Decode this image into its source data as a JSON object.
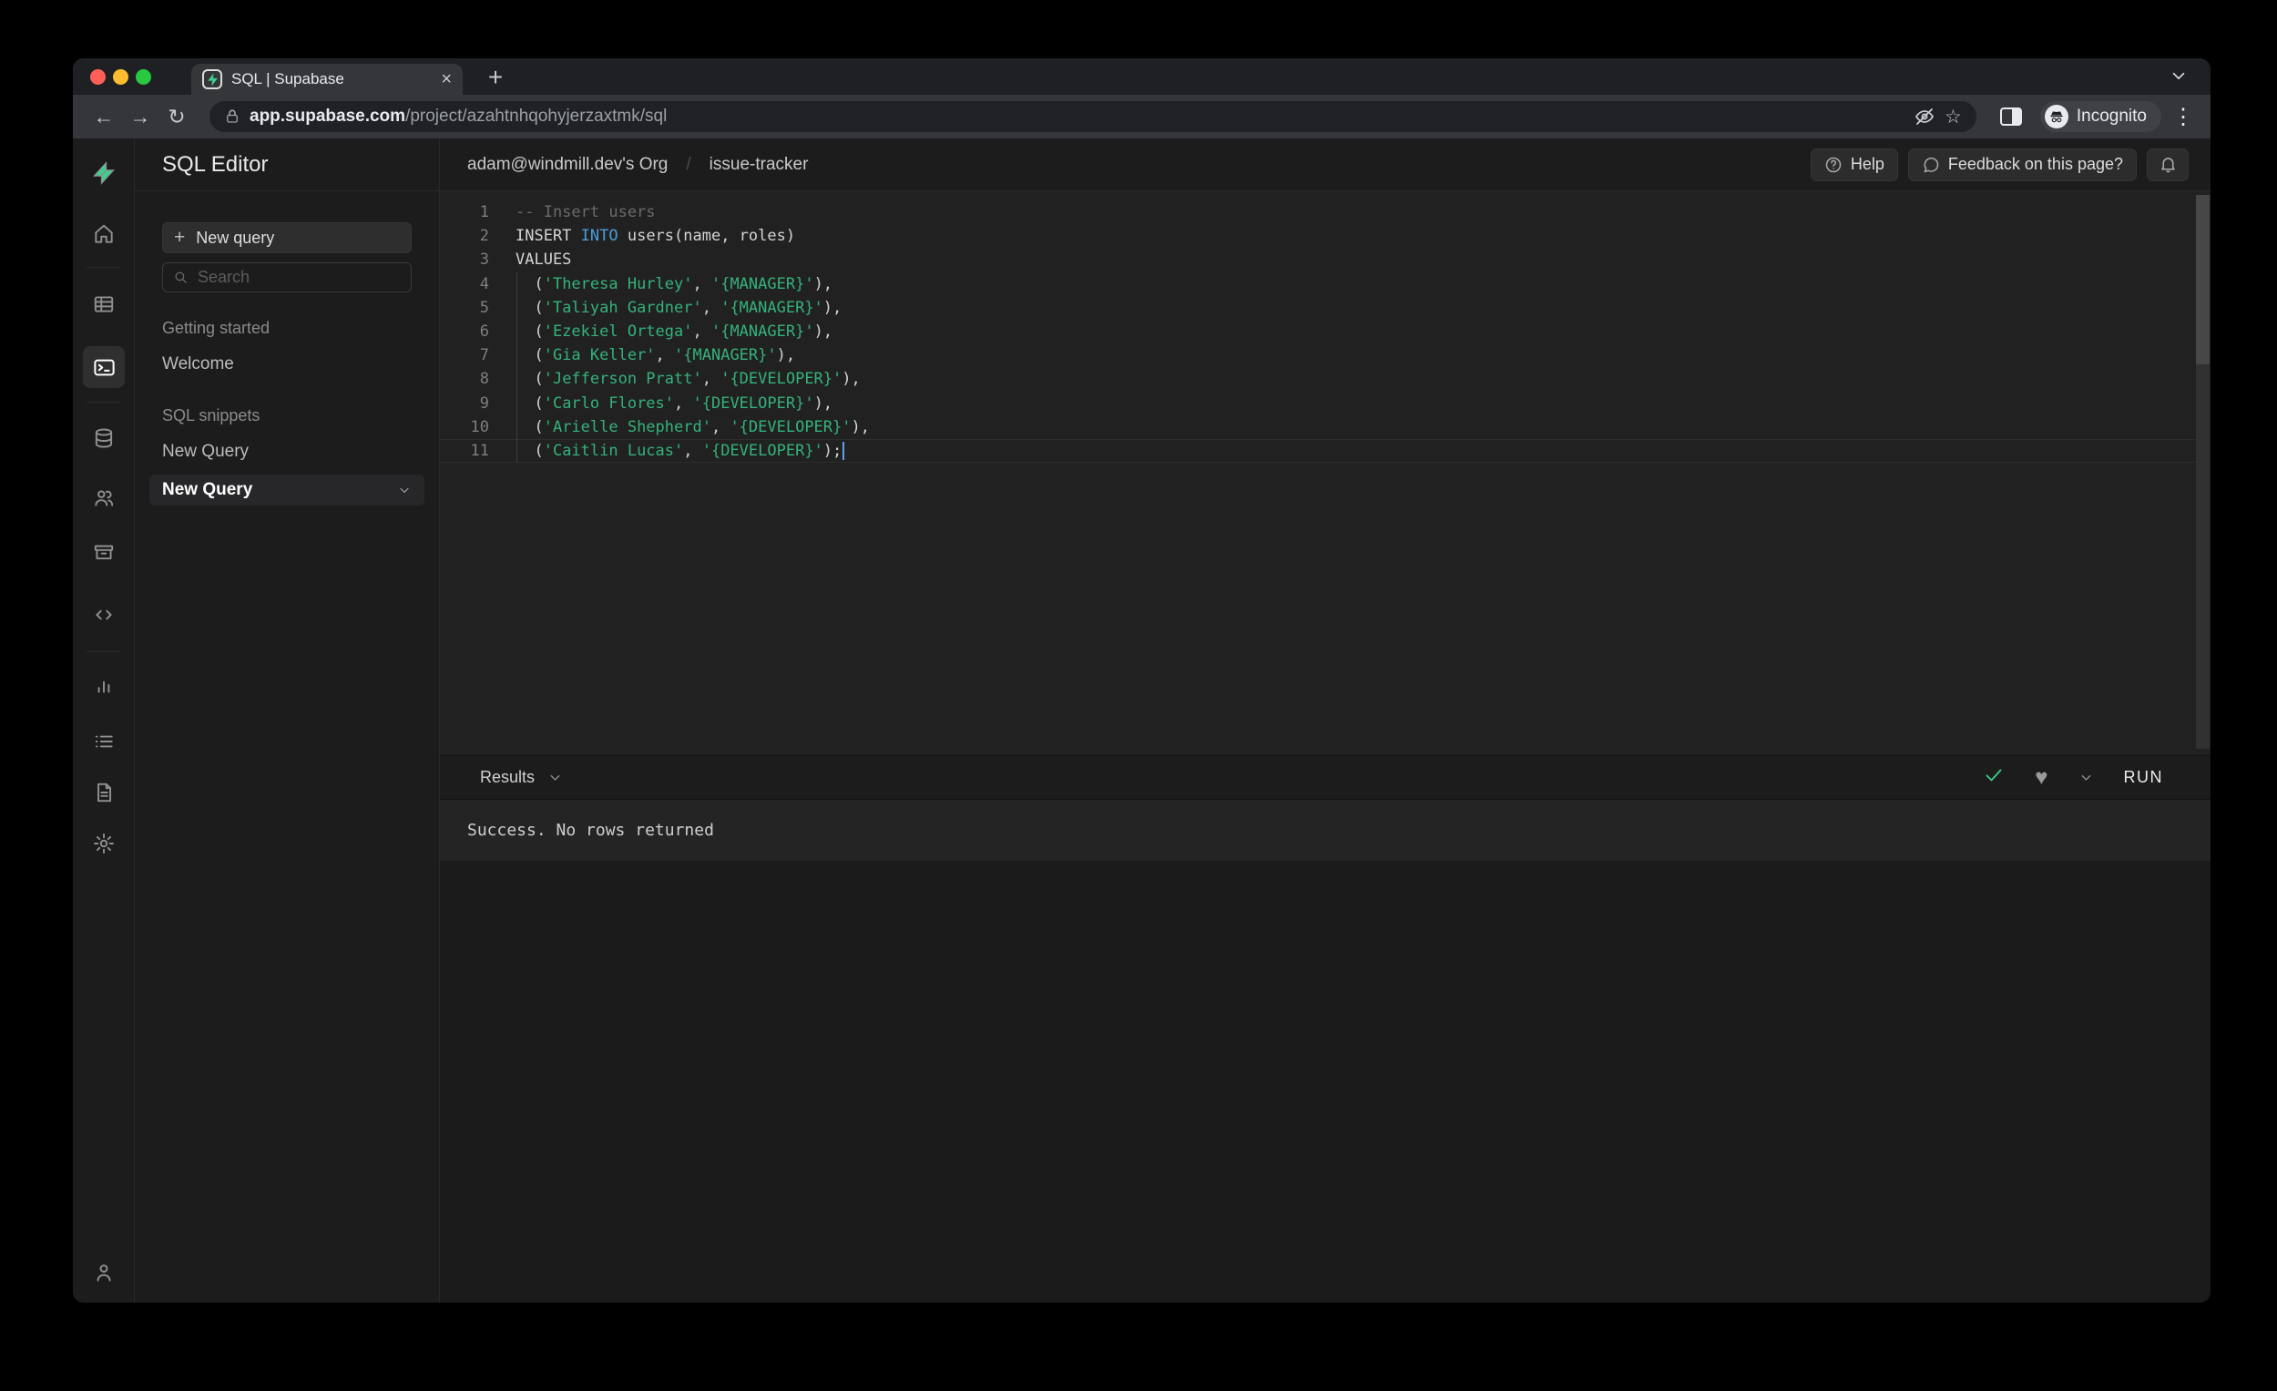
{
  "browser": {
    "tab_title": "SQL | Supabase",
    "url_domain": "app.supabase.com",
    "url_path": "/project/azahtnhqohyjerzaxtmk/sql",
    "incognito_label": "Incognito"
  },
  "icons": {
    "plus": "+",
    "close": "×",
    "kebab": "⋮",
    "back": "←",
    "forward": "→",
    "reload": "↻",
    "star": "☆",
    "heart": "♥",
    "slash": "/"
  },
  "rail": {
    "items": [
      "supabase-logo",
      "home",
      "table-editor",
      "sql-editor",
      "database",
      "authentication",
      "storage",
      "api",
      "reports",
      "logs",
      "docs",
      "settings",
      "account"
    ],
    "selected": "sql-editor"
  },
  "sidebar": {
    "title": "SQL Editor",
    "new_query_button": "New query",
    "search_placeholder": "Search",
    "sections": [
      {
        "header": "Getting started",
        "items": [
          {
            "label": "Welcome",
            "selected": false
          }
        ]
      },
      {
        "header": "SQL snippets",
        "items": [
          {
            "label": "New Query",
            "selected": false
          },
          {
            "label": "New Query",
            "selected": true
          }
        ]
      }
    ]
  },
  "header": {
    "breadcrumb_org": "adam@windmill.dev's Org",
    "breadcrumb_project": "issue-tracker",
    "help_button": "Help",
    "feedback_button": "Feedback on this page?"
  },
  "editor": {
    "colors": {
      "default": "#d4d4d4",
      "keyword": "#4d9ed9",
      "string": "#34b27b",
      "comment": "#6b6b6b",
      "accent": "#3ecf8e"
    },
    "lines": [
      {
        "n": 1,
        "segs": [
          [
            "-- Insert users",
            "c"
          ]
        ]
      },
      {
        "n": 2,
        "segs": [
          [
            "INSERT ",
            "d"
          ],
          [
            "INTO",
            "k"
          ],
          [
            " users(name, roles)",
            "d"
          ]
        ]
      },
      {
        "n": 3,
        "segs": [
          [
            "VALUES",
            "d"
          ]
        ]
      },
      {
        "n": 4,
        "indent": true,
        "segs": [
          [
            "  (",
            "d"
          ],
          [
            "'Theresa Hurley'",
            "s"
          ],
          [
            ", ",
            "d"
          ],
          [
            "'{MANAGER}'",
            "s"
          ],
          [
            "),",
            "d"
          ]
        ]
      },
      {
        "n": 5,
        "indent": true,
        "segs": [
          [
            "  (",
            "d"
          ],
          [
            "'Taliyah Gardner'",
            "s"
          ],
          [
            ", ",
            "d"
          ],
          [
            "'{MANAGER}'",
            "s"
          ],
          [
            "),",
            "d"
          ]
        ]
      },
      {
        "n": 6,
        "indent": true,
        "segs": [
          [
            "  (",
            "d"
          ],
          [
            "'Ezekiel Ortega'",
            "s"
          ],
          [
            ", ",
            "d"
          ],
          [
            "'{MANAGER}'",
            "s"
          ],
          [
            "),",
            "d"
          ]
        ]
      },
      {
        "n": 7,
        "indent": true,
        "segs": [
          [
            "  (",
            "d"
          ],
          [
            "'Gia Keller'",
            "s"
          ],
          [
            ", ",
            "d"
          ],
          [
            "'{MANAGER}'",
            "s"
          ],
          [
            "),",
            "d"
          ]
        ]
      },
      {
        "n": 8,
        "indent": true,
        "segs": [
          [
            "  (",
            "d"
          ],
          [
            "'Jefferson Pratt'",
            "s"
          ],
          [
            ", ",
            "d"
          ],
          [
            "'{DEVELOPER}'",
            "s"
          ],
          [
            "),",
            "d"
          ]
        ]
      },
      {
        "n": 9,
        "indent": true,
        "segs": [
          [
            "  (",
            "d"
          ],
          [
            "'Carlo Flores'",
            "s"
          ],
          [
            ", ",
            "d"
          ],
          [
            "'{DEVELOPER}'",
            "s"
          ],
          [
            "),",
            "d"
          ]
        ]
      },
      {
        "n": 10,
        "indent": true,
        "segs": [
          [
            "  (",
            "d"
          ],
          [
            "'Arielle Shepherd'",
            "s"
          ],
          [
            ", ",
            "d"
          ],
          [
            "'{DEVELOPER}'",
            "s"
          ],
          [
            "),",
            "d"
          ]
        ]
      },
      {
        "n": 11,
        "indent": true,
        "current": true,
        "cursor": true,
        "segs": [
          [
            "  (",
            "d"
          ],
          [
            "'Caitlin Lucas'",
            "s"
          ],
          [
            ", ",
            "d"
          ],
          [
            "'{DEVELOPER}'",
            "s"
          ],
          [
            ");",
            "d"
          ]
        ]
      }
    ]
  },
  "results": {
    "label": "Results",
    "run_button": "RUN",
    "message": "Success. No rows returned"
  }
}
